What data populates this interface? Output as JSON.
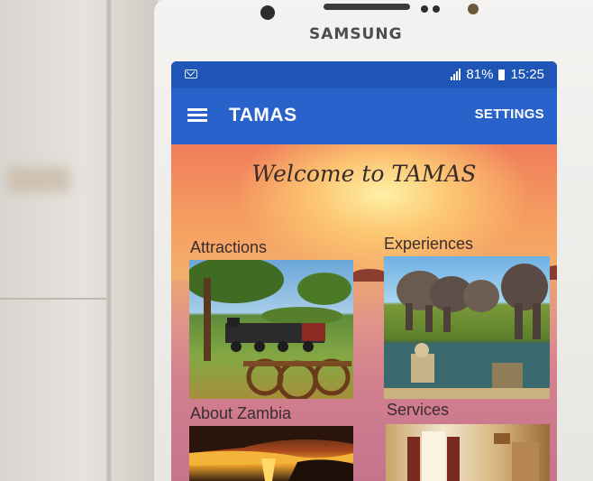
{
  "device": {
    "brand": "SAMSUNG"
  },
  "status_bar": {
    "battery_percent": "81%",
    "time": "15:25",
    "icons": [
      "mail-icon",
      "signal-icon",
      "battery-icon"
    ]
  },
  "app_bar": {
    "title": "TAMAS",
    "settings_label": "SETTINGS",
    "menu_icon": "hamburger-menu-icon",
    "color": "#2a62cc"
  },
  "main": {
    "welcome": "Welcome to TAMAS",
    "tiles": [
      {
        "label": "Attractions"
      },
      {
        "label": "Experiences"
      },
      {
        "label": "About Zambia"
      },
      {
        "label": "Services"
      }
    ]
  }
}
